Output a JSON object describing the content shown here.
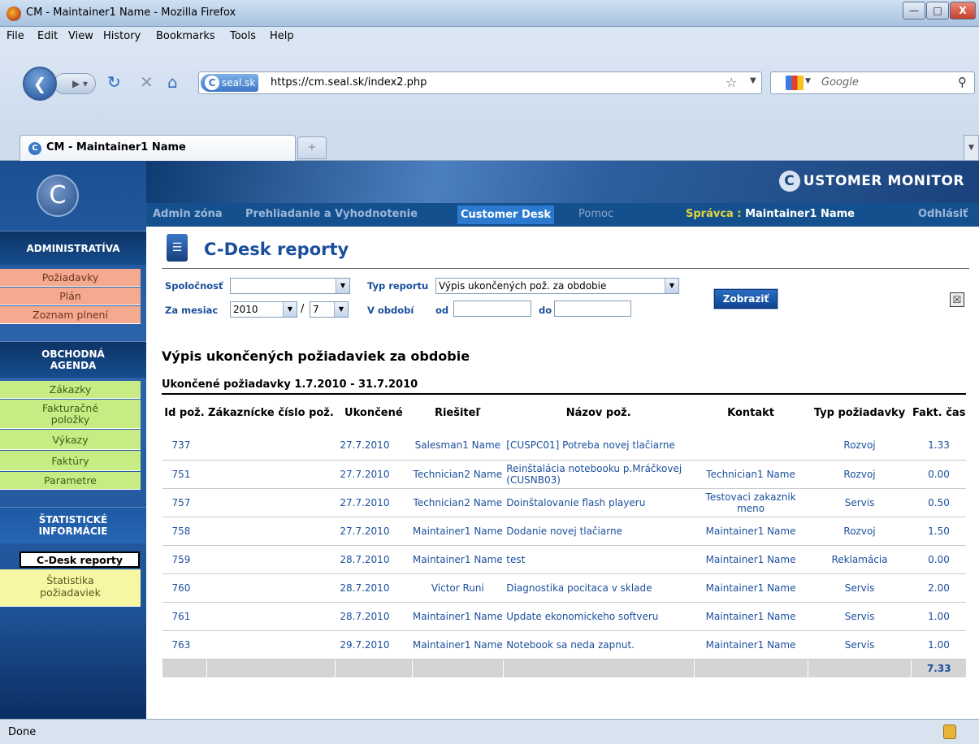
{
  "window": {
    "title": "CM - Maintainer1 Name - Mozilla Firefox"
  },
  "menu": [
    "File",
    "Edit",
    "View",
    "History",
    "Bookmarks",
    "Tools",
    "Help"
  ],
  "address": {
    "site": "seal.sk",
    "url": "https://cm.seal.sk/index2.php"
  },
  "search": {
    "placeholder": "Google"
  },
  "tab": {
    "label": "CM - Maintainer1 Name"
  },
  "app": {
    "logo_rest": "USTOMER MONITOR",
    "logo_c": "C",
    "nav": {
      "admin": "Admin zóna",
      "prehliadanie": "Prehliadanie a Vyhodnotenie",
      "customer_desk": "Customer Desk",
      "pomoc": "Pomoc",
      "spravca_label": "Správca :",
      "spravca_name": "Maintainer1 Name",
      "odhlasit": "Odhlásiť"
    }
  },
  "sidebar": {
    "administrativa": "ADMINISTRATÍVA",
    "admin_items": [
      "Požiadavky",
      "Plán",
      "Zoznam plnení"
    ],
    "obchodna": "OBCHODNÁ AGENDA",
    "obch_items": [
      "Zákazky",
      "Fakturačné položky",
      "Výkazy",
      "Faktúry",
      "Parametre"
    ],
    "statisticke": "ŠTATISTICKÉ INFORMÁCIE",
    "stat_items": [
      "C-Desk reporty",
      "Štatistika požiadaviek"
    ]
  },
  "page": {
    "title": "C-Desk reporty",
    "filters": {
      "spolocnost_label": "Spoločnosť",
      "spolocnost_value": "",
      "typ_label": "Typ reportu",
      "typ_value": "Výpis ukončených pož. za obdobie",
      "mesiac_label": "Za mesiac",
      "year": "2010",
      "sep": "/",
      "month": "7",
      "obdobie_label": "V období",
      "od_label": "od",
      "do_label": "do",
      "od_value": "",
      "do_value": "",
      "button": "Zobraziť"
    },
    "report_title": "Výpis ukončených požiadaviek za obdobie",
    "report_sub": "Ukončené požiadavky  1.7.2010 - 31.7.2010"
  },
  "table": {
    "headers": [
      "Id pož.",
      "Zákaznícke číslo pož.",
      "Ukončené",
      "Riešiteľ",
      "Názov pož.",
      "Kontakt",
      "Typ požiadavky",
      "Fakt. čas"
    ],
    "rows": [
      [
        "737",
        "",
        "27.7.2010",
        "Salesman1 Name",
        "[CUSPC01] Potreba novej tlačiarne",
        "",
        "Rozvoj",
        "1.33"
      ],
      [
        "751",
        "",
        "27.7.2010",
        "Technician2 Name",
        "Reinštalácia notebooku p.Mráčkovej (CUSNB03)",
        "Technician1 Name",
        "Rozvoj",
        "0.00"
      ],
      [
        "757",
        "",
        "27.7.2010",
        "Technician2 Name",
        "Doinštalovanie flash playeru",
        "Testovaci zakaznik meno",
        "Servis",
        "0.50"
      ],
      [
        "758",
        "",
        "27.7.2010",
        "Maintainer1 Name",
        "Dodanie novej tlačiarne",
        "Maintainer1 Name",
        "Rozvoj",
        "1.50"
      ],
      [
        "759",
        "",
        "28.7.2010",
        "Maintainer1 Name",
        "test",
        "Maintainer1 Name",
        "Reklamácia",
        "0.00"
      ],
      [
        "760",
        "",
        "28.7.2010",
        "Victor Runi",
        "Diagnostika pocitaca v sklade",
        "Maintainer1 Name",
        "Servis",
        "2.00"
      ],
      [
        "761",
        "",
        "28.7.2010",
        "Maintainer1 Name",
        "Update ekonomickeho softveru",
        "Maintainer1 Name",
        "Servis",
        "1.00"
      ],
      [
        "763",
        "",
        "29.7.2010",
        "Maintainer1 Name",
        "Notebook sa neda zapnut.",
        "Maintainer1 Name",
        "Servis",
        "1.00"
      ]
    ],
    "total": "7.33"
  },
  "status": {
    "text": "Done"
  }
}
